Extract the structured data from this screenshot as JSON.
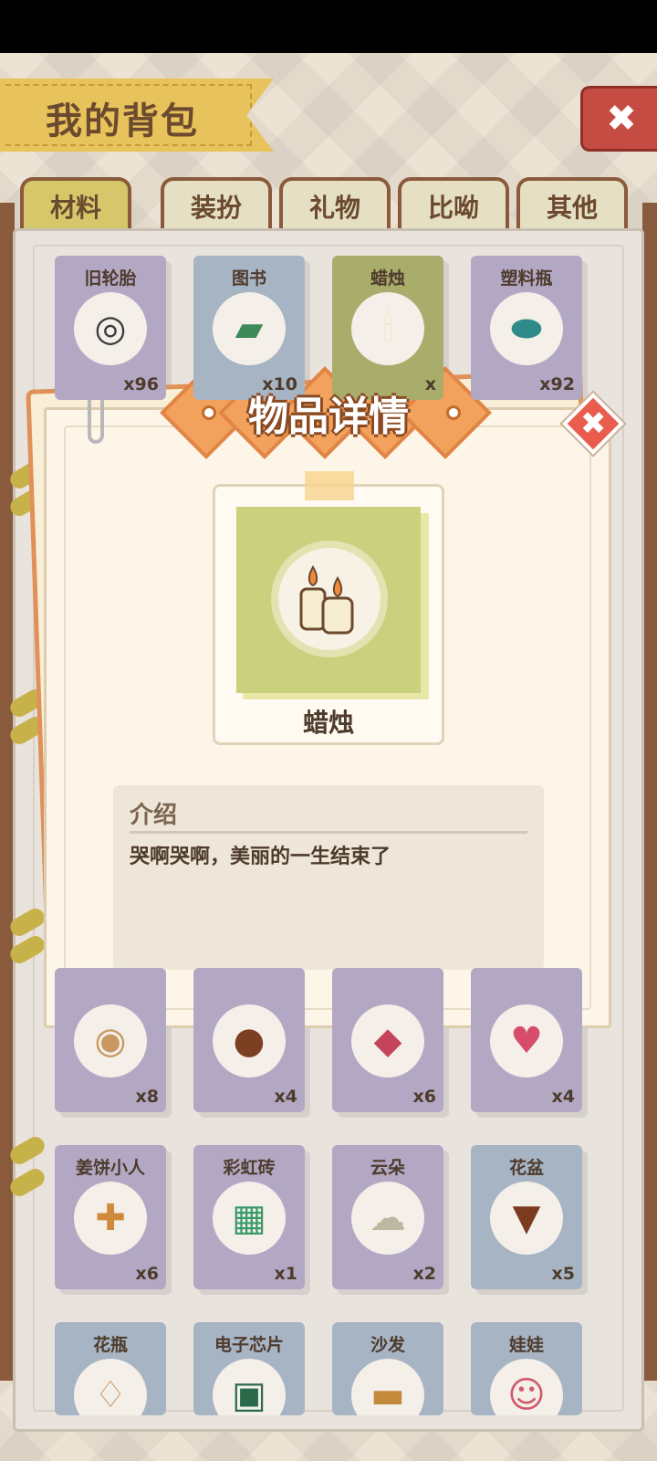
{
  "header": {
    "title": "我的背包"
  },
  "tabs": [
    {
      "label": "材料",
      "active": true
    },
    {
      "label": "装扮",
      "active": false
    },
    {
      "label": "礼物",
      "active": false
    },
    {
      "label": "比呦",
      "active": false
    },
    {
      "label": "其他",
      "active": false
    }
  ],
  "items_row1": [
    {
      "name": "旧轮胎",
      "qty": "x96",
      "icon": "tire-icon",
      "color": "purple"
    },
    {
      "name": "图书",
      "qty": "x10",
      "icon": "book-icon",
      "color": "blue"
    },
    {
      "name": "蜡烛",
      "qty": "x",
      "icon": "candle-icon",
      "color": "green"
    },
    {
      "name": "塑料瓶",
      "qty": "x92",
      "icon": "bottle-icon",
      "color": "purple"
    }
  ],
  "items_row2": [
    {
      "name": "",
      "qty": "x8",
      "icon": "biscuit-icon",
      "color": "purple"
    },
    {
      "name": "",
      "qty": "x4",
      "icon": "coffee-bean-icon",
      "color": "purple"
    },
    {
      "name": "",
      "qty": "x6",
      "icon": "gem-icon",
      "color": "purple"
    },
    {
      "name": "",
      "qty": "x4",
      "icon": "heart-icon",
      "color": "purple"
    }
  ],
  "items_row3": [
    {
      "name": "姜饼小人",
      "qty": "x6",
      "icon": "gingerbread-icon",
      "color": "purple"
    },
    {
      "name": "彩虹砖",
      "qty": "x1",
      "icon": "rainbow-brick-icon",
      "color": "purple"
    },
    {
      "name": "云朵",
      "qty": "x2",
      "icon": "cloud-icon",
      "color": "purple"
    },
    {
      "name": "花盆",
      "qty": "x5",
      "icon": "flowerpot-icon",
      "color": "blue"
    }
  ],
  "items_row4": [
    {
      "name": "花瓶",
      "icon": "vase-icon",
      "color": "blue"
    },
    {
      "name": "电子芯片",
      "icon": "chip-icon",
      "color": "blue"
    },
    {
      "name": "沙发",
      "icon": "sofa-icon",
      "color": "blue"
    },
    {
      "name": "娃娃",
      "icon": "doll-icon",
      "color": "blue"
    }
  ],
  "dialog": {
    "title": "物品详情",
    "item_name": "蜡烛",
    "intro_label": "介绍",
    "intro_text": "哭啊哭啊，美丽的一生结束了"
  },
  "glyphs": {
    "tire": "◎",
    "book": "▰",
    "candle": "🕯",
    "bottle": "⬬",
    "biscuit": "◉",
    "bean": "●",
    "gem": "◆",
    "heart": "♥",
    "ginger": "✚",
    "brick": "▦",
    "cloud": "☁",
    "pot": "▼",
    "vase": "♢",
    "chip": "▣",
    "sofa": "▬",
    "doll": "☺",
    "x": "✖"
  }
}
